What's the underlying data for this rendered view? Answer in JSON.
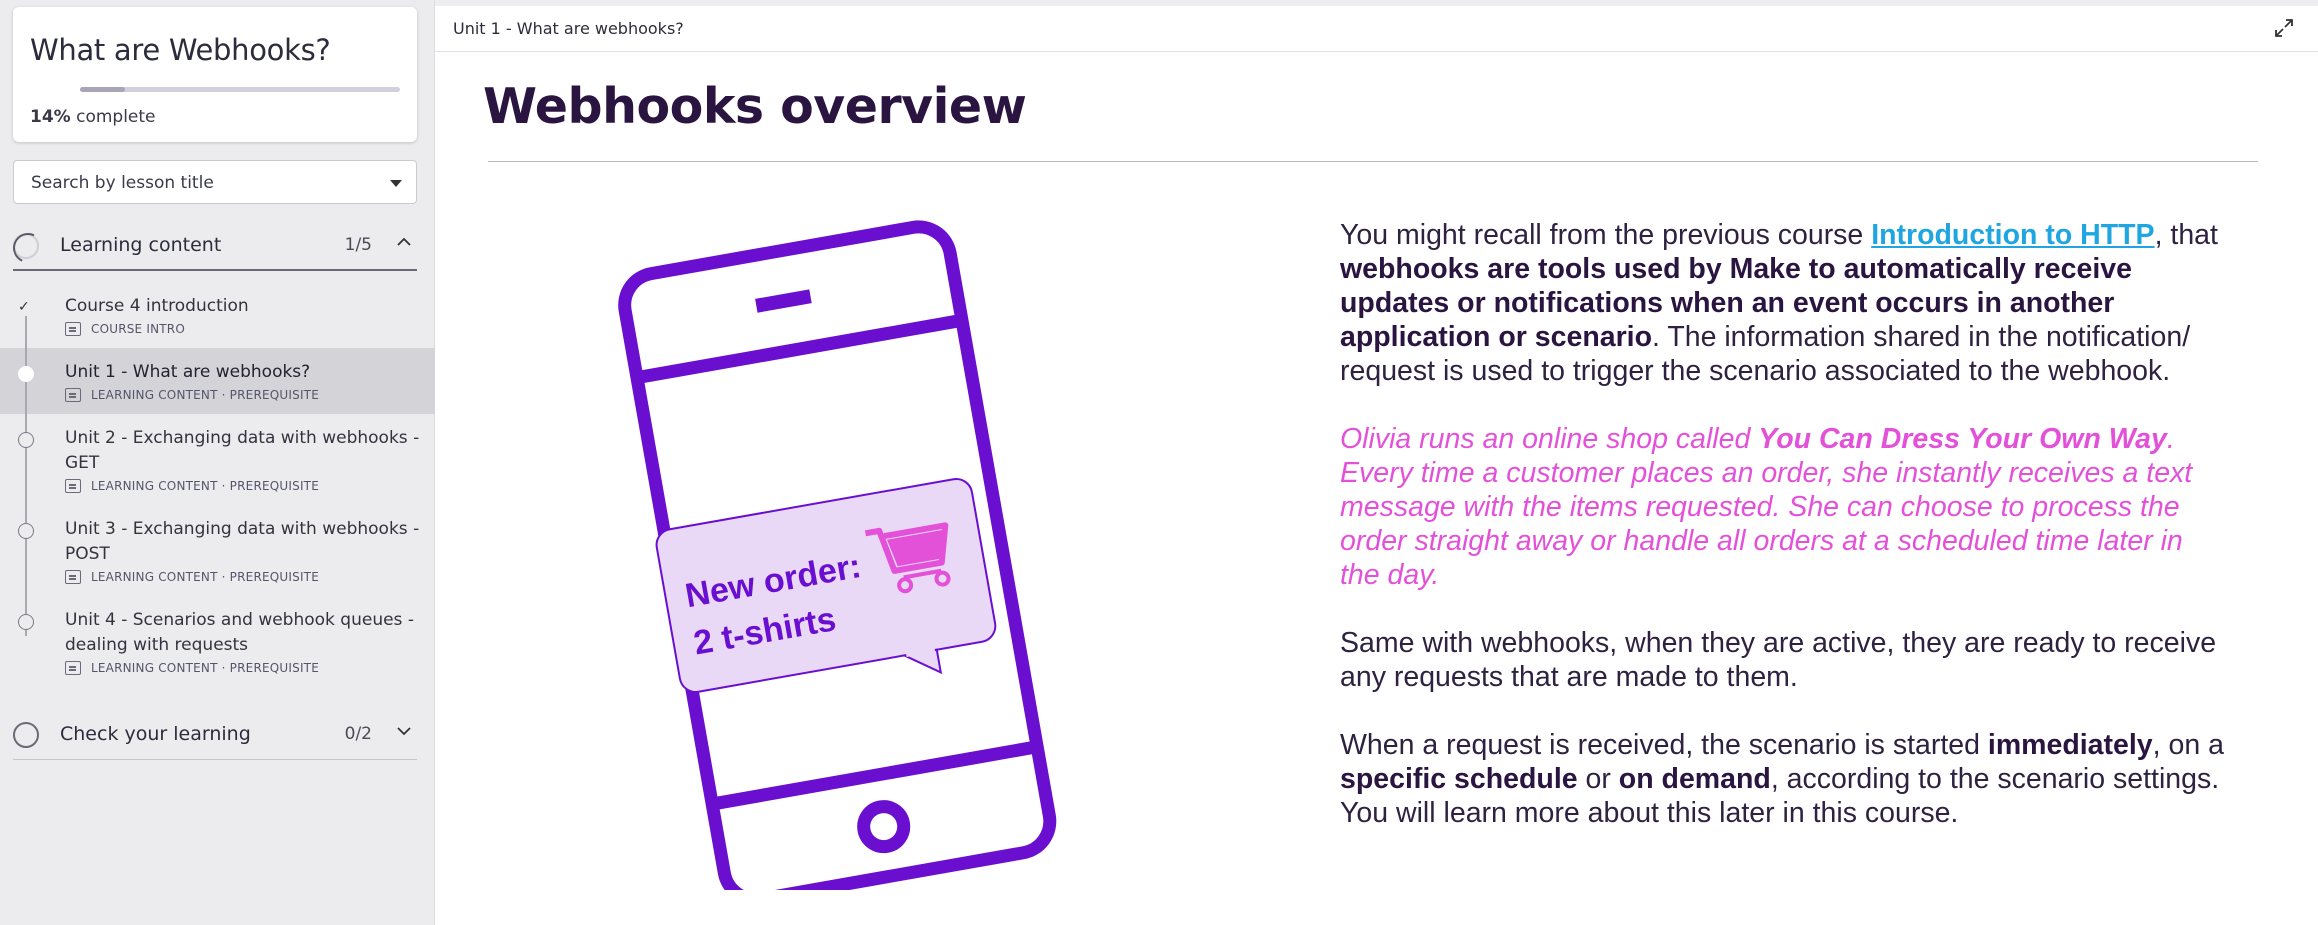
{
  "sidebar": {
    "course_title": "What are Webhooks?",
    "progress_percent_label": "14%",
    "progress_suffix": "complete",
    "progress_fraction": 0.14,
    "search_placeholder": "Search by lesson title",
    "sections": [
      {
        "label": "Learning content",
        "count": "1/5",
        "expanded": true
      },
      {
        "label": "Check your learning",
        "count": "0/2",
        "expanded": false
      }
    ],
    "lessons": [
      {
        "title": "Course 4 introduction",
        "meta": "COURSE INTRO",
        "completed": true
      },
      {
        "title": "Unit 1 - What are webhooks?",
        "meta": "LEARNING CONTENT · PREREQUISITE",
        "active": true
      },
      {
        "title": "Unit 2 - Exchanging data with webhooks - GET",
        "meta": "LEARNING CONTENT · PREREQUISITE"
      },
      {
        "title": "Unit 3 - Exchanging data with webhooks - POST",
        "meta": "LEARNING CONTENT · PREREQUISITE"
      },
      {
        "title": "Unit 4 - Scenarios and webhook queues - dealing with requests",
        "meta": "LEARNING CONTENT · PREREQUISITE"
      }
    ]
  },
  "topbar": {
    "breadcrumb": "Unit 1 - What are webhooks?"
  },
  "main": {
    "title": "Webhooks overview",
    "illustration": {
      "bubble_line1": "New order:",
      "bubble_line2": "2  t-shirts",
      "phone_color": "#6a0fcf",
      "bubble_fill": "#e9d9f7",
      "cart_color": "#e351d9"
    },
    "paragraphs": {
      "p1_a": "You might recall from the previous course ",
      "p1_link": "Introduction to HTTP",
      "p1_b": ", that ",
      "p1_bold": "webhooks are tools used by Make to automatically receive updates or notifications when an event occurs in another application or scenario",
      "p1_c": ". The information shared in the notification/ request is used to trigger the scenario associated to the webhook.",
      "p2_a": "Olivia runs an online shop called ",
      "p2_bold": "You Can Dress Your Own Way",
      "p2_b": ". Every time a customer places an order, she instantly receives a text message with the items requested. She can choose to process the order straight away or handle all orders at a scheduled time later in the day.",
      "p3": "Same with webhooks, when they are active, they are ready to receive any requests that are made to them.",
      "p4_a": "When a request is received, the scenario is started ",
      "p4_bold1": "immediately",
      "p4_b": ", on a ",
      "p4_bold2": "specific schedule",
      "p4_c": " or ",
      "p4_bold3": "on demand",
      "p4_d": ", according to the scenario settings. You will learn more about this later in this course."
    },
    "colors": {
      "link": "#1fa6e0",
      "accent_italic": "#e351d9",
      "title": "#2a1440"
    }
  }
}
